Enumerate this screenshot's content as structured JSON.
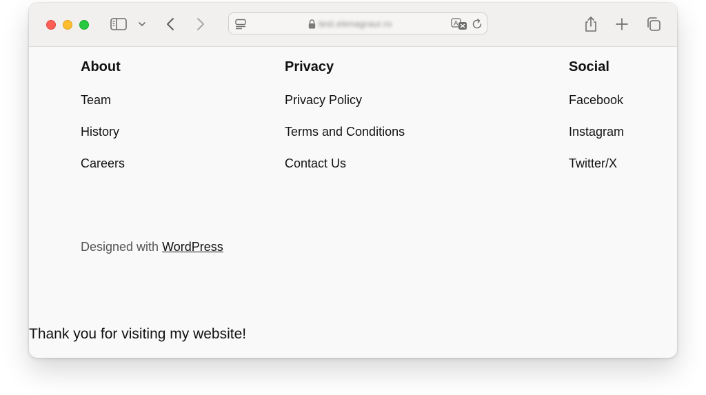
{
  "browser": {
    "url": "test.elenagraur.ro",
    "translate_badge": "A",
    "icons": [
      "sidebar-icon",
      "chevron-down-icon",
      "back-icon",
      "forward-icon",
      "reader-icon",
      "lock-icon",
      "translate-icon",
      "reload-icon",
      "share-icon",
      "new-tab-icon",
      "tabs-overview-icon"
    ]
  },
  "footer": {
    "about": {
      "heading": "About",
      "links": [
        "Team",
        "History",
        "Careers"
      ]
    },
    "privacy": {
      "heading": "Privacy",
      "links": [
        "Privacy Policy",
        "Terms and Conditions",
        "Contact Us"
      ]
    },
    "social": {
      "heading": "Social",
      "links": [
        "Facebook",
        "Instagram",
        "Twitter/X"
      ]
    },
    "credit_prefix": "Designed with ",
    "credit_link": "WordPress",
    "thanks": "Thank you for visiting my website!"
  },
  "colors": {
    "red": "#ff5f57",
    "yellow": "#febc2e",
    "green": "#28c840",
    "page_bg": "#f9f9f9",
    "toolbar_bg": "#f1f0ef"
  }
}
